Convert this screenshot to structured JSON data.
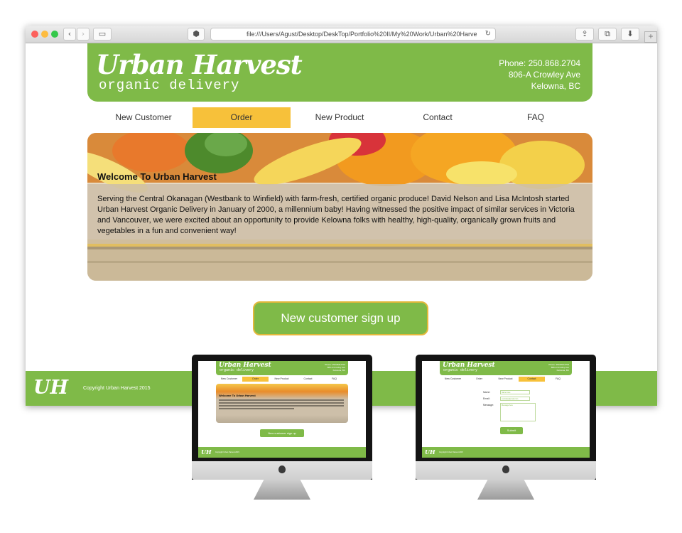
{
  "browser": {
    "url": "file:///Users/Agust/Desktop/DeskTop/Portfolio%20II/My%20Work/Urban%20Harve",
    "tab_plus": "+",
    "back_glyph": "‹",
    "forward_glyph": "›",
    "reload_glyph": "↻",
    "share_glyph": "⇪",
    "tabs_glyph": "⧉",
    "download_glyph": "⬇",
    "sidebar_glyph": "▭",
    "shield_glyph": "⬢"
  },
  "site": {
    "logo_main": "Urban Harvest",
    "logo_sub": "organic delivery",
    "contact": {
      "phone": "Phone: 250.868.2704",
      "address": "806-A Crowley Ave",
      "city": "Kelowna, BC"
    },
    "nav": [
      {
        "label": "New Customer",
        "active": false
      },
      {
        "label": "Order",
        "active": true
      },
      {
        "label": "New Product",
        "active": false
      },
      {
        "label": "Contact",
        "active": false
      },
      {
        "label": "FAQ",
        "active": false
      }
    ],
    "hero": {
      "title": "Welcome To Urban Harvest",
      "text": "Serving the Central Okanagan (Westbank to Winfield) with farm-fresh, certified organic produce! David Nelson and Lisa McIntosh started Urban Harvest Organic Delivery in January of 2000, a millennium baby! Having witnessed the positive impact of similar services in Victoria and Vancouver, we were excited about an opportunity to provide Kelowna folks with healthy, high-quality, organically grown fruits and vegetables in a fun and convenient way!"
    },
    "cta": "New customer sign up",
    "footer": {
      "logo": "UH",
      "copyright": "Copyright Urban Harvest 2015"
    }
  },
  "mockups": {
    "contact_form": {
      "name_label": "Name:",
      "email_label": "Email:",
      "message_label": "Message:",
      "name_placeholder": "Name here",
      "email_placeholder": "example@email.com",
      "message_placeholder": "Message here",
      "submit": "Submit"
    }
  },
  "colors": {
    "brand_green": "#7fba48",
    "accent_yellow": "#f7c13a"
  }
}
